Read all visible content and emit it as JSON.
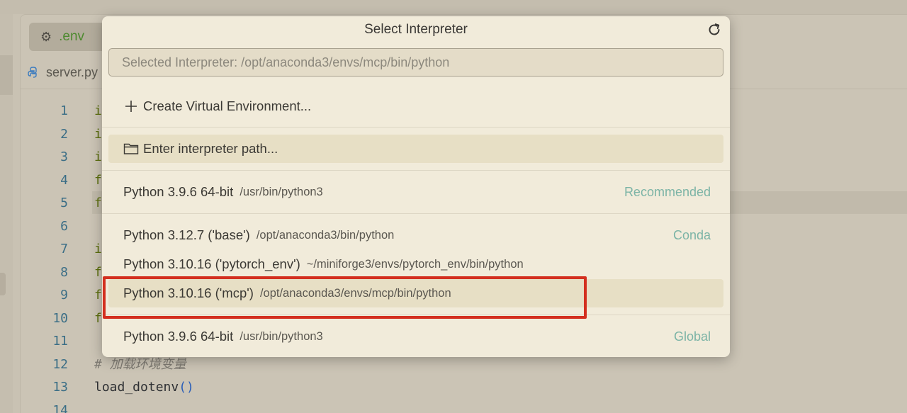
{
  "editor": {
    "env_tab_label": ".env",
    "file_tab_label": "server.py",
    "line_numbers": [
      "1",
      "2",
      "3",
      "4",
      "5",
      "6",
      "7",
      "8",
      "9",
      "10",
      "11",
      "12",
      "13",
      "14"
    ],
    "code_lines": [
      {
        "text": "i",
        "style": "kw"
      },
      {
        "text": "i",
        "style": "kw"
      },
      {
        "text": "i",
        "style": "kw"
      },
      {
        "text": "f",
        "style": "kw"
      },
      {
        "text": "f",
        "style": "kw"
      },
      {
        "text": "",
        "style": "kw"
      },
      {
        "text": "i",
        "style": "kw"
      },
      {
        "text": "f",
        "style": "kw"
      },
      {
        "text": "f",
        "style": "kw"
      },
      {
        "text": "f",
        "style": "kw"
      },
      {
        "text": "",
        "style": "kw"
      },
      {
        "text": "# 加载环境变量",
        "style": "cm"
      }
    ],
    "line13_fn": "load_dotenv",
    "line13_parens": "()"
  },
  "dialog": {
    "title": "Select Interpreter",
    "refresh_icon": "refresh-icon",
    "input_placeholder": "Selected Interpreter: /opt/anaconda3/envs/mcp/bin/python",
    "input_value": "",
    "create_label": "Create Virtual Environment...",
    "create_icon": "plus-icon",
    "enter_label": "Enter interpreter path...",
    "enter_icon": "folder-icon",
    "items": [
      {
        "name": "Python 3.9.6 64-bit",
        "path": "/usr/bin/python3",
        "badge": "Recommended"
      },
      {
        "name": "Python 3.12.7 ('base')",
        "path": "/opt/anaconda3/bin/python",
        "badge": "Conda"
      },
      {
        "name": "Python 3.10.16 ('pytorch_env')",
        "path": "~/miniforge3/envs/pytorch_env/bin/python",
        "badge": ""
      },
      {
        "name": "Python 3.10.16 ('mcp')",
        "path": "/opt/anaconda3/envs/mcp/bin/python",
        "badge": ""
      },
      {
        "name": "Python 3.9.6 64-bit",
        "path": "/usr/bin/python3",
        "badge": "Global"
      }
    ],
    "highlight_color": "#d32f1f"
  }
}
